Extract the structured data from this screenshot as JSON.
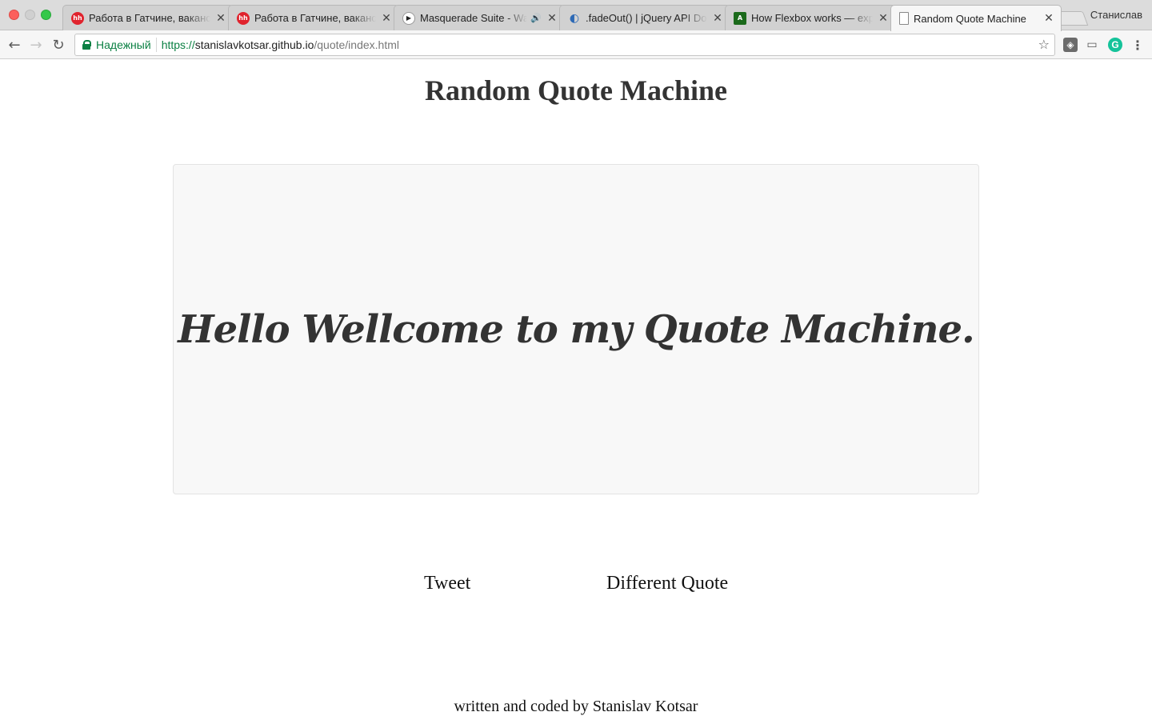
{
  "browser": {
    "tabs": [
      {
        "title": "Работа в Гатчине, вакансии",
        "favicon": "hh-icon",
        "active": false
      },
      {
        "title": "Работа в Гатчине, вакансии",
        "favicon": "hh-icon",
        "active": false
      },
      {
        "title": "Masquerade Suite - Waltz",
        "favicon": "youtube-icon",
        "active": false,
        "audio": "🔊"
      },
      {
        "title": ".fadeOut() | jQuery API Documentation",
        "favicon": "jquery-icon",
        "active": false
      },
      {
        "title": "How Flexbox works — explained",
        "favicon": "flexbox-icon",
        "active": false
      },
      {
        "title": "Random Quote Machine",
        "favicon": "page-icon",
        "active": true
      }
    ],
    "close_glyph": "✕",
    "profile_name": "Станислав",
    "security_label": "Надежный",
    "url": {
      "scheme": "https://",
      "host": "stanislavkotsar.github.io",
      "path": "/quote/index.html"
    }
  },
  "page": {
    "title": "Random Quote Machine",
    "quote": "Hello Wellcome to my Quote Machine.",
    "buttons": {
      "tweet": "Tweet",
      "different_quote": "Different Quote"
    },
    "footer": "written and coded by Stanislav Kotsar"
  }
}
